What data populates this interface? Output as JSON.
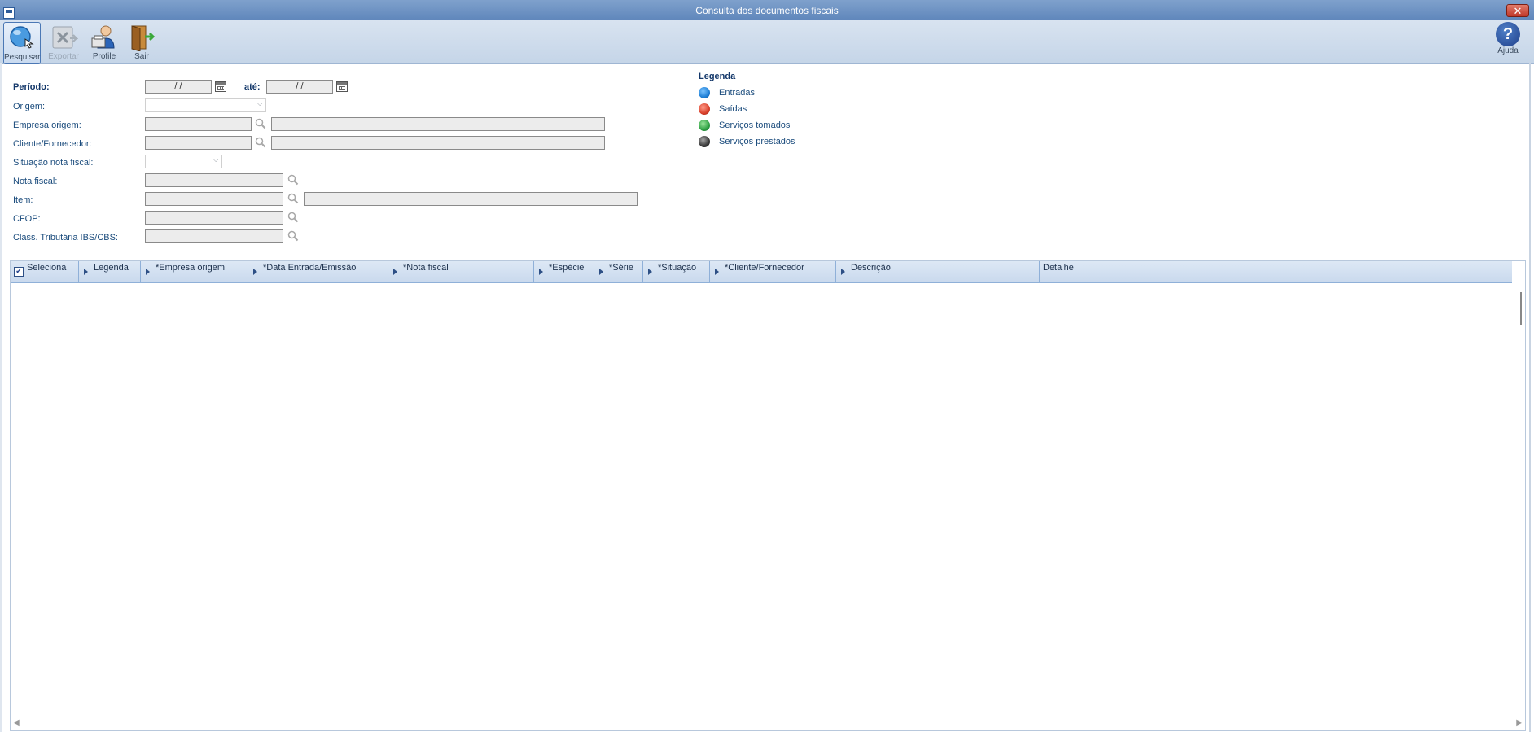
{
  "window": {
    "title": "Consulta dos documentos fiscais",
    "close_label": "✕"
  },
  "toolbar": {
    "search_label": "Pesquisar",
    "export_label": "Exportar",
    "profile_label": "Profile",
    "exit_label": "Sair",
    "help_label": "Ajuda",
    "help_glyph": "?"
  },
  "form": {
    "period_label": "Período:",
    "period_from": " / /",
    "until_label": "até:",
    "period_to": " / /",
    "origin_label": "Origem:",
    "origin_value": "",
    "company_origin_label": "Empresa origem:",
    "company_origin_code": "",
    "company_origin_name": "",
    "client_supplier_label": "Cliente/Fornecedor:",
    "client_supplier_code": "",
    "client_supplier_name": "",
    "invoice_status_label": "Situação nota fiscal:",
    "invoice_status_value": "",
    "invoice_label": "Nota fiscal:",
    "invoice_value": "",
    "item_label": "Item:",
    "item_code": "",
    "item_name": "",
    "cfop_label": "CFOP:",
    "cfop_value": "",
    "tax_class_label": "Class. Tributária IBS/CBS:",
    "tax_class_value": ""
  },
  "legend": {
    "title": "Legenda",
    "items": [
      {
        "label": "Entradas",
        "color": "#1e7fd6"
      },
      {
        "label": "Saídas",
        "color": "#d9402b"
      },
      {
        "label": "Serviços tomados",
        "color": "#2ea043"
      },
      {
        "label": "Serviços prestados",
        "color": "#3a3a3a"
      }
    ]
  },
  "grid": {
    "columns": [
      {
        "label": "Seleciona"
      },
      {
        "label": "Legenda"
      },
      {
        "label": "*Empresa origem"
      },
      {
        "label": "*Data Entrada/Emissão"
      },
      {
        "label": "*Nota fiscal"
      },
      {
        "label": "*Espécie"
      },
      {
        "label": "*Série"
      },
      {
        "label": "*Situação"
      },
      {
        "label": "*Cliente/Fornecedor"
      },
      {
        "label": "Descrição"
      },
      {
        "label": "Detalhe"
      }
    ],
    "select_all_checked": true
  }
}
